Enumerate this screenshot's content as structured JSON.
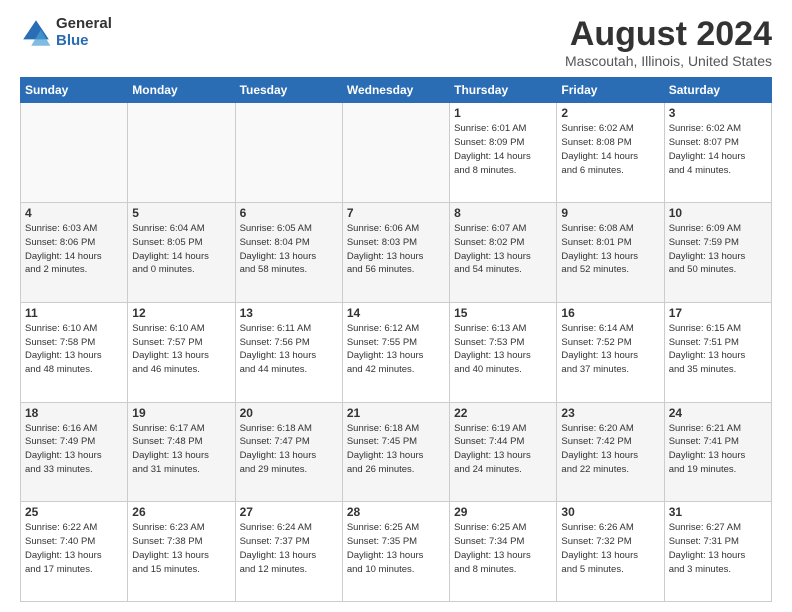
{
  "logo": {
    "general": "General",
    "blue": "Blue"
  },
  "header": {
    "month": "August 2024",
    "location": "Mascoutah, Illinois, United States"
  },
  "weekdays": [
    "Sunday",
    "Monday",
    "Tuesday",
    "Wednesday",
    "Thursday",
    "Friday",
    "Saturday"
  ],
  "weeks": [
    [
      {
        "day": "",
        "info": ""
      },
      {
        "day": "",
        "info": ""
      },
      {
        "day": "",
        "info": ""
      },
      {
        "day": "",
        "info": ""
      },
      {
        "day": "1",
        "info": "Sunrise: 6:01 AM\nSunset: 8:09 PM\nDaylight: 14 hours\nand 8 minutes."
      },
      {
        "day": "2",
        "info": "Sunrise: 6:02 AM\nSunset: 8:08 PM\nDaylight: 14 hours\nand 6 minutes."
      },
      {
        "day": "3",
        "info": "Sunrise: 6:02 AM\nSunset: 8:07 PM\nDaylight: 14 hours\nand 4 minutes."
      }
    ],
    [
      {
        "day": "4",
        "info": "Sunrise: 6:03 AM\nSunset: 8:06 PM\nDaylight: 14 hours\nand 2 minutes."
      },
      {
        "day": "5",
        "info": "Sunrise: 6:04 AM\nSunset: 8:05 PM\nDaylight: 14 hours\nand 0 minutes."
      },
      {
        "day": "6",
        "info": "Sunrise: 6:05 AM\nSunset: 8:04 PM\nDaylight: 13 hours\nand 58 minutes."
      },
      {
        "day": "7",
        "info": "Sunrise: 6:06 AM\nSunset: 8:03 PM\nDaylight: 13 hours\nand 56 minutes."
      },
      {
        "day": "8",
        "info": "Sunrise: 6:07 AM\nSunset: 8:02 PM\nDaylight: 13 hours\nand 54 minutes."
      },
      {
        "day": "9",
        "info": "Sunrise: 6:08 AM\nSunset: 8:01 PM\nDaylight: 13 hours\nand 52 minutes."
      },
      {
        "day": "10",
        "info": "Sunrise: 6:09 AM\nSunset: 7:59 PM\nDaylight: 13 hours\nand 50 minutes."
      }
    ],
    [
      {
        "day": "11",
        "info": "Sunrise: 6:10 AM\nSunset: 7:58 PM\nDaylight: 13 hours\nand 48 minutes."
      },
      {
        "day": "12",
        "info": "Sunrise: 6:10 AM\nSunset: 7:57 PM\nDaylight: 13 hours\nand 46 minutes."
      },
      {
        "day": "13",
        "info": "Sunrise: 6:11 AM\nSunset: 7:56 PM\nDaylight: 13 hours\nand 44 minutes."
      },
      {
        "day": "14",
        "info": "Sunrise: 6:12 AM\nSunset: 7:55 PM\nDaylight: 13 hours\nand 42 minutes."
      },
      {
        "day": "15",
        "info": "Sunrise: 6:13 AM\nSunset: 7:53 PM\nDaylight: 13 hours\nand 40 minutes."
      },
      {
        "day": "16",
        "info": "Sunrise: 6:14 AM\nSunset: 7:52 PM\nDaylight: 13 hours\nand 37 minutes."
      },
      {
        "day": "17",
        "info": "Sunrise: 6:15 AM\nSunset: 7:51 PM\nDaylight: 13 hours\nand 35 minutes."
      }
    ],
    [
      {
        "day": "18",
        "info": "Sunrise: 6:16 AM\nSunset: 7:49 PM\nDaylight: 13 hours\nand 33 minutes."
      },
      {
        "day": "19",
        "info": "Sunrise: 6:17 AM\nSunset: 7:48 PM\nDaylight: 13 hours\nand 31 minutes."
      },
      {
        "day": "20",
        "info": "Sunrise: 6:18 AM\nSunset: 7:47 PM\nDaylight: 13 hours\nand 29 minutes."
      },
      {
        "day": "21",
        "info": "Sunrise: 6:18 AM\nSunset: 7:45 PM\nDaylight: 13 hours\nand 26 minutes."
      },
      {
        "day": "22",
        "info": "Sunrise: 6:19 AM\nSunset: 7:44 PM\nDaylight: 13 hours\nand 24 minutes."
      },
      {
        "day": "23",
        "info": "Sunrise: 6:20 AM\nSunset: 7:42 PM\nDaylight: 13 hours\nand 22 minutes."
      },
      {
        "day": "24",
        "info": "Sunrise: 6:21 AM\nSunset: 7:41 PM\nDaylight: 13 hours\nand 19 minutes."
      }
    ],
    [
      {
        "day": "25",
        "info": "Sunrise: 6:22 AM\nSunset: 7:40 PM\nDaylight: 13 hours\nand 17 minutes."
      },
      {
        "day": "26",
        "info": "Sunrise: 6:23 AM\nSunset: 7:38 PM\nDaylight: 13 hours\nand 15 minutes."
      },
      {
        "day": "27",
        "info": "Sunrise: 6:24 AM\nSunset: 7:37 PM\nDaylight: 13 hours\nand 12 minutes."
      },
      {
        "day": "28",
        "info": "Sunrise: 6:25 AM\nSunset: 7:35 PM\nDaylight: 13 hours\nand 10 minutes."
      },
      {
        "day": "29",
        "info": "Sunrise: 6:25 AM\nSunset: 7:34 PM\nDaylight: 13 hours\nand 8 minutes."
      },
      {
        "day": "30",
        "info": "Sunrise: 6:26 AM\nSunset: 7:32 PM\nDaylight: 13 hours\nand 5 minutes."
      },
      {
        "day": "31",
        "info": "Sunrise: 6:27 AM\nSunset: 7:31 PM\nDaylight: 13 hours\nand 3 minutes."
      }
    ]
  ]
}
